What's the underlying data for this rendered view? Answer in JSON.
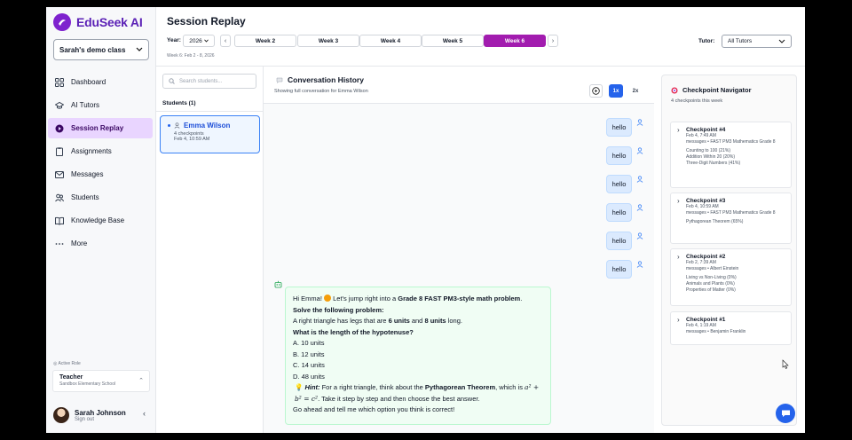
{
  "app": {
    "name": "EduSeek AI",
    "class_selector": "Sarah's demo class"
  },
  "nav": [
    {
      "label": "Dashboard",
      "icon": "grid-icon"
    },
    {
      "label": "AI Tutors",
      "icon": "graduation-cap-icon"
    },
    {
      "label": "Session Replay",
      "icon": "replay-icon",
      "active": true
    },
    {
      "label": "Assignments",
      "icon": "clipboard-icon"
    },
    {
      "label": "Messages",
      "icon": "mail-icon"
    },
    {
      "label": "Students",
      "icon": "users-icon"
    },
    {
      "label": "Knowledge Base",
      "icon": "book-icon"
    },
    {
      "label": "More",
      "icon": "more-icon"
    }
  ],
  "role": {
    "label": "Active Role",
    "title": "Teacher",
    "school": "Sandbox Elementary School"
  },
  "user": {
    "name": "Sarah Johnson",
    "action": "Sign out"
  },
  "header": {
    "title": "Session Replay",
    "year_label": "Year:",
    "year": "2026",
    "weeks": [
      "Week 2",
      "Week 3",
      "Week 4",
      "Week 5",
      "Week 6"
    ],
    "active_week": "Week 6",
    "week_range": "Week 6: Feb 2 - 8, 2026",
    "tutor_label": "Tutor:",
    "tutor_value": "All Tutors"
  },
  "students": {
    "search_placeholder": "Search students...",
    "count_label": "Students (1)",
    "items": [
      {
        "name": "Emma Wilson",
        "checkpoints": "4 checkpoints",
        "date": "Feb 4, 10:59 AM"
      }
    ]
  },
  "conversation": {
    "title": "Conversation History",
    "subtitle": "Showing full conversation for Emma Wilson",
    "speeds": [
      "1x",
      "2x"
    ],
    "user_messages": [
      "hello",
      "hello",
      "hello",
      "hello",
      "hello",
      "hello"
    ],
    "bot": {
      "greeting_a": "Hi Emma! ",
      "greeting_b": " Let's jump right into a ",
      "greeting_bold": "Grade 8 FAST PM3-style math problem",
      "greeting_end": ".",
      "solve": "Solve the following problem:",
      "problem_a": "A right triangle has legs that are ",
      "problem_b1": "6 units",
      "problem_and": " and ",
      "problem_b2": "8 units",
      "problem_end": " long.",
      "question": "What is the length of the hypotenuse?",
      "options": [
        "A. 10 units",
        "B. 12 units",
        "C. 14 units",
        "D. 48 units"
      ],
      "hint_label": "Hint:",
      "hint_a": " For a right triangle, think about the ",
      "hint_bold": "Pythagorean Theorem",
      "hint_b": ", which is ",
      "formula_1": "a² + b² = c²",
      "hint_c": ". Take it step by step and then choose the best answer.",
      "closing": "Go ahead and tell me which option you think is correct!"
    }
  },
  "checkpoints": {
    "title": "Checkpoint Navigator",
    "subtitle": "4 checkpoints this week",
    "items": [
      {
        "name": "Checkpoint #4",
        "time": "Feb 4, 7:49 AM",
        "source": "messages • FAST PM3 Mathematics Grade 8",
        "topics": [
          "Counting to 100 (21%)",
          "Addition Within 20 (20%)",
          "Three-Digit Numbers (41%)"
        ]
      },
      {
        "name": "Checkpoint #3",
        "time": "Feb 4, 10:59 AM",
        "source": "messages • FAST PM3 Mathematics Grade 8",
        "topics": [
          "Pythagorean Theorem (65%)"
        ]
      },
      {
        "name": "Checkpoint #2",
        "time": "Feb 2, 7:39 AM",
        "source": "messages • Albert Einstein",
        "topics": [
          "Living vs Non-Living (0%)",
          "Animals and Plants (0%)",
          "Properties of Matter (0%)"
        ]
      },
      {
        "name": "Checkpoint #1",
        "time": "Feb 4, 1:19 AM",
        "source": "messages • Benjamin Franklin",
        "topics": []
      }
    ]
  },
  "colors": {
    "brand": "#5b21b6",
    "active_week": "#a21caf",
    "accent": "#2563eb",
    "bot_bg": "#f0fdf4"
  }
}
